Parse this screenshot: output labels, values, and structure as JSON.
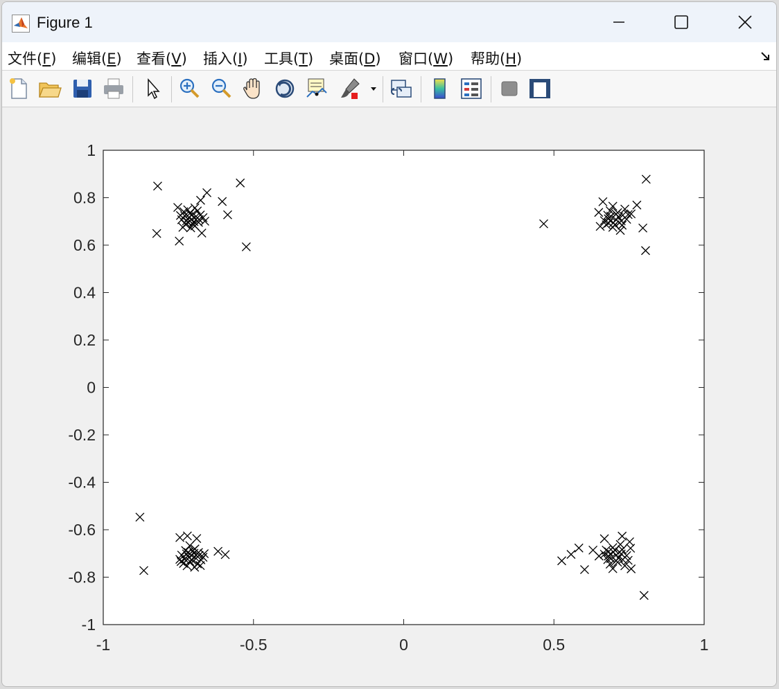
{
  "window": {
    "title": "Figure 1"
  },
  "menu": {
    "items": [
      {
        "label": "文件(",
        "key": "F",
        "tail": ")"
      },
      {
        "label": "编辑(",
        "key": "E",
        "tail": ")"
      },
      {
        "label": "查看(",
        "key": "V",
        "tail": ")"
      },
      {
        "label": "插入(",
        "key": "I",
        "tail": ")"
      },
      {
        "label": "工具(",
        "key": "T",
        "tail": ")"
      },
      {
        "label": "桌面(",
        "key": "D",
        "tail": ")"
      },
      {
        "label": "窗口(",
        "key": "W",
        "tail": ")"
      },
      {
        "label": "帮助(",
        "key": "H",
        "tail": ")"
      }
    ]
  },
  "toolbar": {
    "icons": [
      "new-figure-icon",
      "open-file-icon",
      "save-icon",
      "print-icon",
      "pointer-icon",
      "zoom-in-icon",
      "zoom-out-icon",
      "pan-hand-icon",
      "rotate-3d-icon",
      "data-cursor-icon",
      "brush-icon",
      "link-plot-icon",
      "colorbar-icon",
      "legend-icon",
      "hide-plot-tools-icon",
      "show-plot-tools-icon"
    ]
  },
  "chart_data": {
    "type": "scatter",
    "marker": "x",
    "marker_color": "#000000",
    "xlim": [
      -1,
      1
    ],
    "ylim": [
      -1,
      1
    ],
    "x_ticks": [
      -1,
      -0.5,
      0,
      0.5,
      1
    ],
    "x_tick_labels": [
      "-1",
      "-0.5",
      "0",
      "0.5",
      "1"
    ],
    "y_ticks": [
      1,
      0.8,
      0.6,
      0.4,
      0.2,
      0,
      -0.2,
      -0.4,
      -0.6,
      -0.8,
      -1
    ],
    "y_tick_labels": [
      "1",
      "0.8",
      "0.6",
      "0.4",
      "0.2",
      "0",
      "-0.2",
      "-0.4",
      "-0.6",
      "-0.8",
      "-1"
    ],
    "grid": false,
    "series": [
      {
        "points": [
          [
            -0.819,
            0.849
          ],
          [
            -0.544,
            0.862
          ],
          [
            -0.655,
            0.821
          ],
          [
            -0.604,
            0.784
          ],
          [
            -0.586,
            0.728
          ],
          [
            -0.524,
            0.593
          ],
          [
            -0.822,
            0.649
          ],
          [
            -0.752,
            0.759
          ],
          [
            -0.747,
            0.617
          ],
          [
            -0.735,
            0.675
          ],
          [
            -0.672,
            0.651
          ],
          [
            -0.676,
            0.789
          ],
          [
            -0.707,
            0.707
          ],
          [
            -0.715,
            0.717
          ],
          [
            -0.698,
            0.699
          ],
          [
            -0.723,
            0.702
          ],
          [
            -0.691,
            0.721
          ],
          [
            -0.702,
            0.689
          ],
          [
            -0.729,
            0.724
          ],
          [
            -0.681,
            0.708
          ],
          [
            -0.712,
            0.733
          ],
          [
            -0.695,
            0.681
          ],
          [
            -0.739,
            0.707
          ],
          [
            -0.668,
            0.716
          ],
          [
            -0.687,
            0.744
          ],
          [
            -0.726,
            0.688
          ],
          [
            -0.705,
            0.728
          ],
          [
            -0.717,
            0.696
          ],
          [
            -0.683,
            0.696
          ],
          [
            -0.743,
            0.725
          ],
          [
            -0.662,
            0.701
          ],
          [
            -0.695,
            0.757
          ],
          [
            -0.732,
            0.741
          ],
          [
            -0.709,
            0.673
          ],
          [
            -0.677,
            0.727
          ],
          [
            -0.719,
            0.749
          ],
          [
            0.466,
            0.69
          ],
          [
            0.807,
            0.878
          ],
          [
            0.796,
            0.672
          ],
          [
            0.805,
            0.577
          ],
          [
            0.776,
            0.769
          ],
          [
            0.649,
            0.738
          ],
          [
            0.663,
            0.783
          ],
          [
            0.654,
            0.679
          ],
          [
            0.707,
            0.707
          ],
          [
            0.715,
            0.719
          ],
          [
            0.698,
            0.694
          ],
          [
            0.724,
            0.702
          ],
          [
            0.689,
            0.722
          ],
          [
            0.703,
            0.686
          ],
          [
            0.729,
            0.726
          ],
          [
            0.681,
            0.711
          ],
          [
            0.712,
            0.737
          ],
          [
            0.696,
            0.675
          ],
          [
            0.742,
            0.709
          ],
          [
            0.668,
            0.703
          ],
          [
            0.687,
            0.745
          ],
          [
            0.727,
            0.684
          ],
          [
            0.707,
            0.731
          ],
          [
            0.718,
            0.694
          ],
          [
            0.682,
            0.693
          ],
          [
            0.747,
            0.729
          ],
          [
            0.674,
            0.686
          ],
          [
            0.696,
            0.764
          ],
          [
            0.736,
            0.752
          ],
          [
            0.757,
            0.732
          ],
          [
            0.679,
            0.726
          ],
          [
            0.721,
            0.662
          ],
          [
            -0.878,
            -0.547
          ],
          [
            -0.865,
            -0.772
          ],
          [
            -0.618,
            -0.691
          ],
          [
            -0.594,
            -0.705
          ],
          [
            -0.745,
            -0.633
          ],
          [
            -0.72,
            -0.626
          ],
          [
            -0.689,
            -0.637
          ],
          [
            -0.741,
            -0.734
          ],
          [
            -0.677,
            -0.751
          ],
          [
            -0.707,
            -0.707
          ],
          [
            -0.715,
            -0.717
          ],
          [
            -0.698,
            -0.699
          ],
          [
            -0.723,
            -0.702
          ],
          [
            -0.691,
            -0.721
          ],
          [
            -0.702,
            -0.689
          ],
          [
            -0.729,
            -0.724
          ],
          [
            -0.681,
            -0.708
          ],
          [
            -0.712,
            -0.733
          ],
          [
            -0.695,
            -0.681
          ],
          [
            -0.739,
            -0.707
          ],
          [
            -0.668,
            -0.716
          ],
          [
            -0.687,
            -0.744
          ],
          [
            -0.726,
            -0.688
          ],
          [
            -0.705,
            -0.728
          ],
          [
            -0.717,
            -0.696
          ],
          [
            -0.683,
            -0.696
          ],
          [
            -0.745,
            -0.725
          ],
          [
            -0.664,
            -0.701
          ],
          [
            -0.696,
            -0.758
          ],
          [
            -0.733,
            -0.742
          ],
          [
            -0.712,
            -0.667
          ],
          [
            -0.675,
            -0.727
          ],
          [
            -0.721,
            -0.752
          ],
          [
            0.526,
            -0.731
          ],
          [
            0.557,
            -0.704
          ],
          [
            0.583,
            -0.677
          ],
          [
            0.602,
            -0.768
          ],
          [
            0.63,
            -0.686
          ],
          [
            0.8,
            -0.877
          ],
          [
            0.757,
            -0.765
          ],
          [
            0.65,
            -0.711
          ],
          [
            0.668,
            -0.638
          ],
          [
            0.727,
            -0.627
          ],
          [
            0.752,
            -0.651
          ],
          [
            0.707,
            -0.707
          ],
          [
            0.715,
            -0.719
          ],
          [
            0.698,
            -0.694
          ],
          [
            0.724,
            -0.702
          ],
          [
            0.689,
            -0.722
          ],
          [
            0.703,
            -0.686
          ],
          [
            0.729,
            -0.726
          ],
          [
            0.681,
            -0.711
          ],
          [
            0.712,
            -0.737
          ],
          [
            0.696,
            -0.675
          ],
          [
            0.742,
            -0.709
          ],
          [
            0.668,
            -0.703
          ],
          [
            0.687,
            -0.745
          ],
          [
            0.727,
            -0.684
          ],
          [
            0.707,
            -0.731
          ],
          [
            0.718,
            -0.694
          ],
          [
            0.682,
            -0.693
          ],
          [
            0.747,
            -0.729
          ],
          [
            0.674,
            -0.686
          ],
          [
            0.696,
            -0.764
          ],
          [
            0.736,
            -0.752
          ],
          [
            0.755,
            -0.678
          ],
          [
            0.679,
            -0.726
          ],
          [
            0.721,
            -0.662
          ]
        ]
      }
    ]
  }
}
